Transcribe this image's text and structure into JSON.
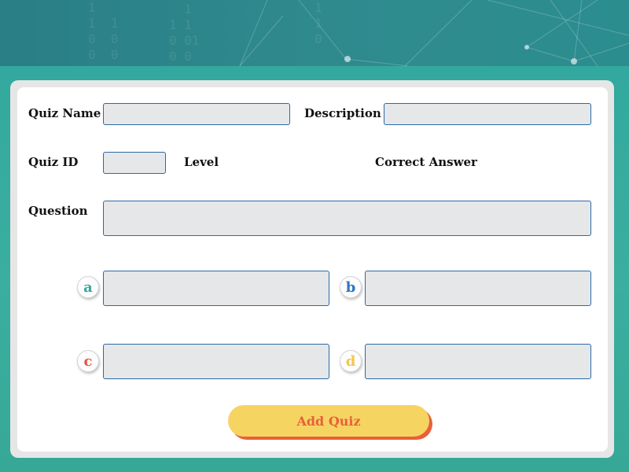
{
  "form": {
    "quiz_name_label": "Quiz Name",
    "quiz_name_value": "",
    "description_label": "Description",
    "description_value": "",
    "quiz_id_label": "Quiz ID",
    "quiz_id_value": "",
    "level_label": "Level",
    "correct_answer_label": "Correct Answer",
    "question_label": "Question",
    "question_value": ""
  },
  "options": [
    {
      "letter": "a",
      "color": "#3aa89c",
      "value": ""
    },
    {
      "letter": "b",
      "color": "#2b77c2",
      "value": ""
    },
    {
      "letter": "c",
      "color": "#e2553f",
      "value": ""
    },
    {
      "letter": "d",
      "color": "#f0c84a",
      "value": ""
    }
  ],
  "add_button_label": "Add Quiz",
  "colors": {
    "accent_yellow": "#f6d462",
    "accent_orange": "#e8603a",
    "field_border": "#2b6aa8",
    "background_teal": "#2f8c8c"
  }
}
